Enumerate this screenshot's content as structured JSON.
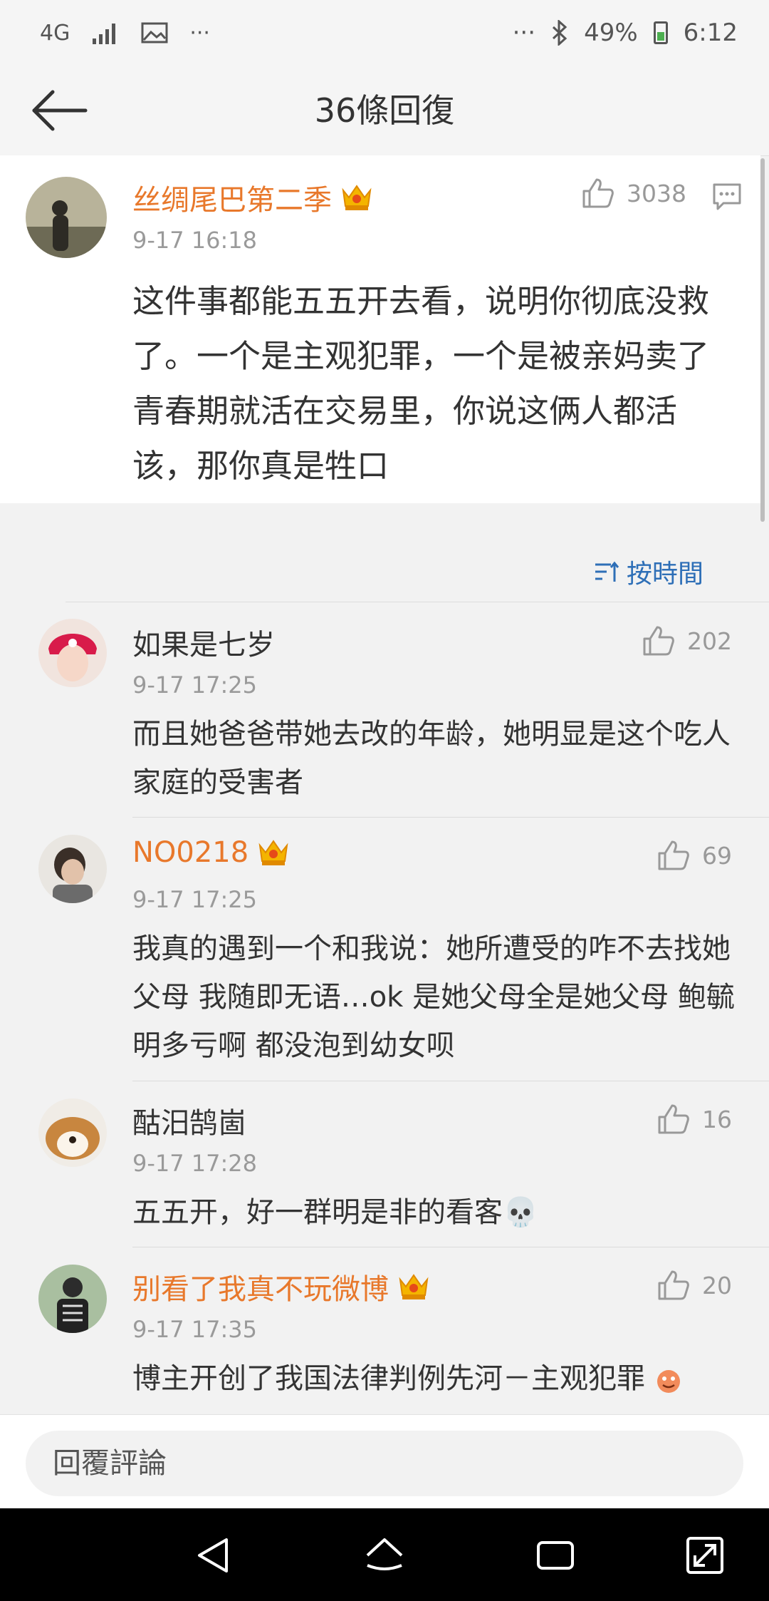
{
  "status_bar": {
    "network": "4G",
    "battery": "49%",
    "time": "6:12",
    "more": "···"
  },
  "nav": {
    "title": "36條回復"
  },
  "main_comment": {
    "username": "丝绸尾巴第二季",
    "vip": true,
    "time": "9-17 16:18",
    "likes": "3038",
    "text": "这件事都能五五开去看，说明你彻底没救了。一个是主观犯罪，一个是被亲妈卖了青春期就活在交易里，你说这俩人都活该，那你真是牲口"
  },
  "sort": {
    "label": "按時間"
  },
  "replies": [
    {
      "username": "如果是七岁",
      "vip": false,
      "time": "9-17 17:25",
      "likes": "202",
      "text": "而且她爸爸带她去改的年龄，她明显是这个吃人家庭的受害者"
    },
    {
      "username": "NO0218",
      "vip": true,
      "time": "9-17 17:25",
      "likes": "69",
      "text": "我真的遇到一个和我说：她所遭受的咋不去找她父母 我随即无语…ok 是她父母全是她父母 鲍毓明多亏啊 都没泡到幼女呗"
    },
    {
      "username": "酤汨鹄崮",
      "vip": false,
      "time": "9-17 17:28",
      "likes": "16",
      "text": "五五开，好一群明是非的看客💀"
    },
    {
      "username": "别看了我真不玩微博",
      "vip": true,
      "time": "9-17 17:35",
      "likes": "20",
      "text": "博主开创了我国法律判例先河－主观犯罪"
    }
  ],
  "input": {
    "placeholder": "回覆評論"
  },
  "colors": {
    "vip_name": "#e8782b",
    "link_blue": "#2e6fb7",
    "background": "#f2f2f2"
  }
}
